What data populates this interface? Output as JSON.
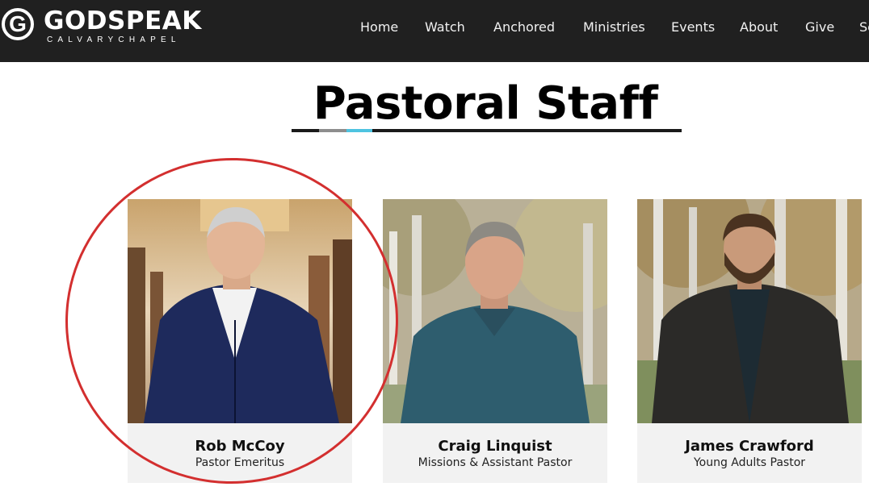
{
  "header": {
    "logo_word": "GODSPEAK",
    "logo_letter": "G",
    "logo_sub": "CALVARYCHAPEL",
    "nav": [
      "Home",
      "Watch",
      "Anchored",
      "Ministries",
      "Events",
      "About",
      "Give",
      "Se"
    ]
  },
  "page": {
    "title": "Pastoral Staff"
  },
  "staff": [
    {
      "name": "Rob McCoy",
      "role": "Pastor Emeritus"
    },
    {
      "name": "Craig Linquist",
      "role": "Missions & Assistant Pastor"
    },
    {
      "name": "James Crawford",
      "role": "Young Adults Pastor"
    }
  ],
  "colors": {
    "header_bg": "#202020",
    "accent_blue": "#4ec3e0",
    "highlight_red": "#d32f2f",
    "card_bg": "#f2f2f2"
  }
}
